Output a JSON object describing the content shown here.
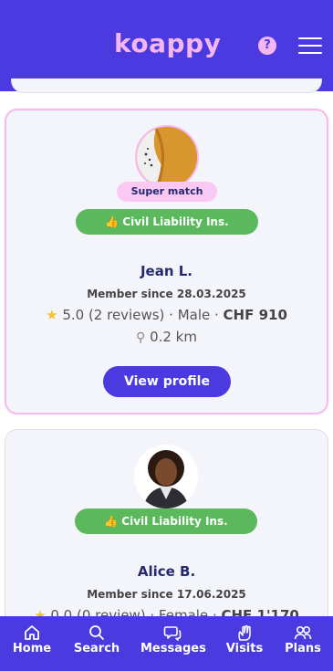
{
  "header": {
    "logo": "koappy",
    "help_symbol": "?",
    "help_icon": "help-circle-icon",
    "menu_icon": "hamburger-menu-icon"
  },
  "cards": [
    {
      "badge": "Super match",
      "insurance": "Civil Liability Ins.",
      "name": "Jean L.",
      "member_since": "Member since 28.03.2025",
      "rating": "5.0 (2 reviews)",
      "gender": "Male",
      "price": "CHF 910",
      "distance": "0.2 km",
      "button": "View profile"
    },
    {
      "insurance": "Civil Liability Ins.",
      "name": "Alice B.",
      "member_since": "Member since 17.06.2025",
      "rating": "0.0 (0 review)",
      "gender": "Female",
      "price": "CHF 1'170"
    }
  ],
  "nav": [
    {
      "label": "Home",
      "icon": "home-icon"
    },
    {
      "label": "Search",
      "icon": "search-icon"
    },
    {
      "label": "Messages",
      "icon": "messages-icon"
    },
    {
      "label": "Visits",
      "icon": "visits-icon"
    },
    {
      "label": "Plans",
      "icon": "plans-icon"
    }
  ],
  "colors": {
    "primary": "#4a3ae0",
    "accent_pink": "#f3b6f0",
    "success_green": "#5cb85c",
    "name_navy": "#262870"
  }
}
